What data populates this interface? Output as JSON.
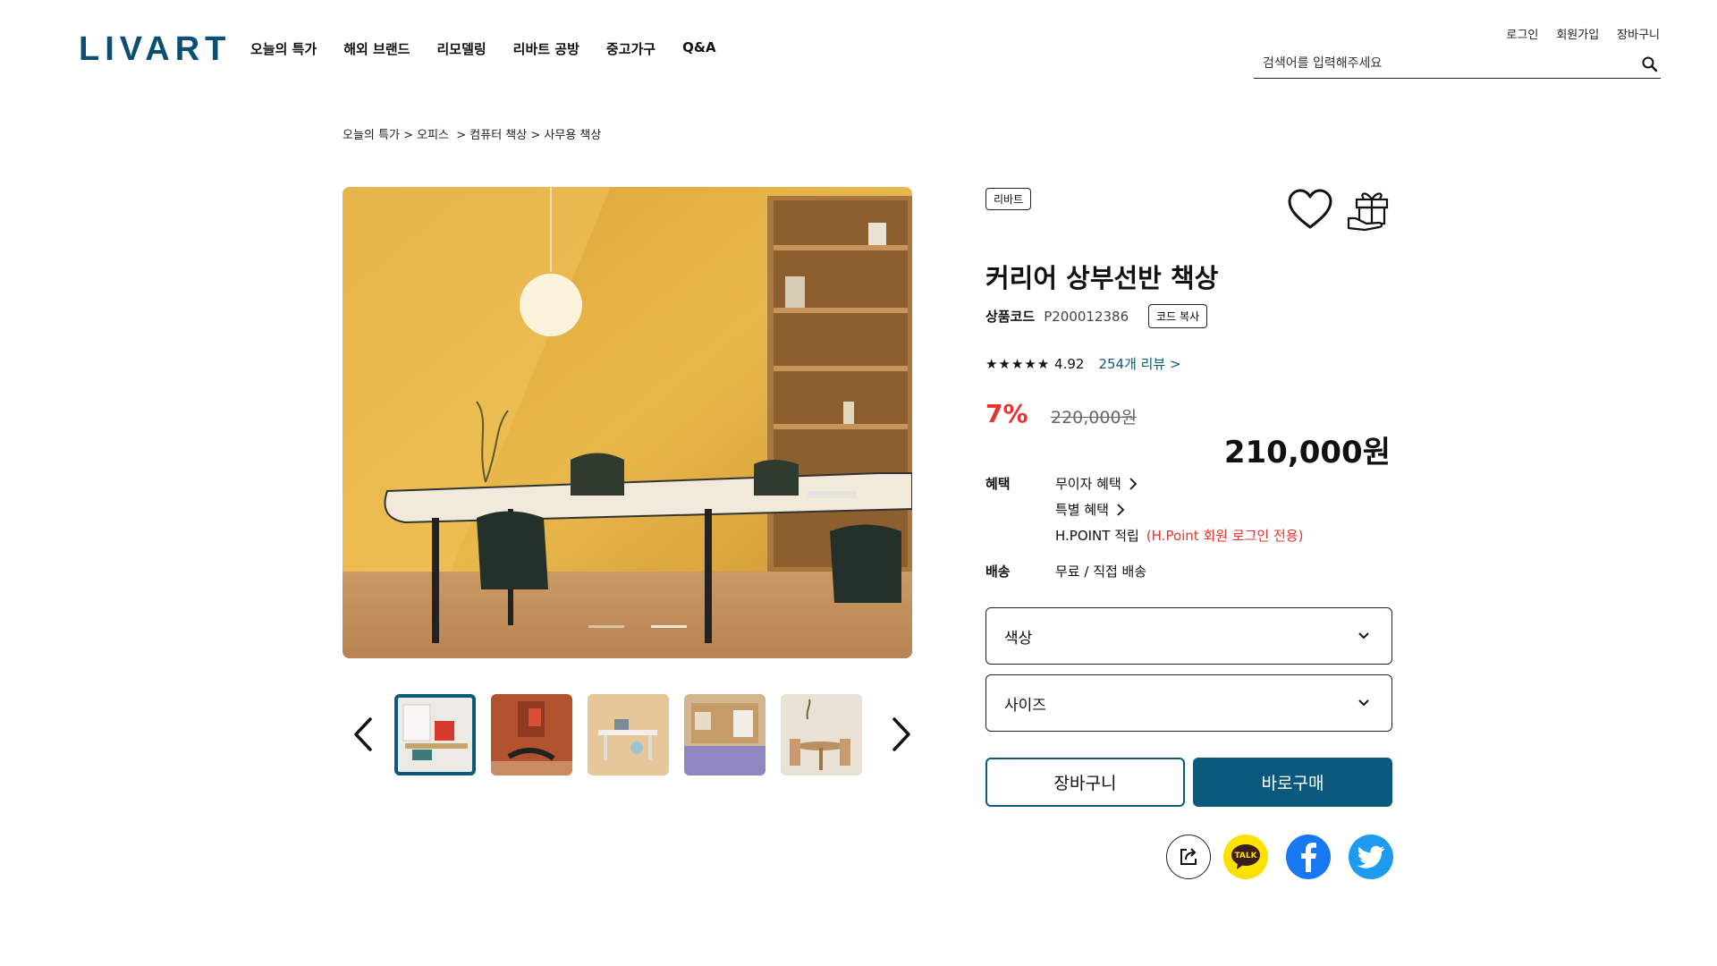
{
  "header": {
    "logo": "LIVART",
    "nav": [
      "오늘의 특가",
      "해외 브랜드",
      "리모델링",
      "리바트 공방",
      "중고가구",
      "Q&A"
    ],
    "util": [
      "로그인",
      "회원가입",
      "장바구니"
    ],
    "search_placeholder": "검색어를 입력해주세요"
  },
  "breadcrumb": [
    "오늘의 특가",
    "오피스",
    "컴퓨터 책상",
    "사무용 책상"
  ],
  "product": {
    "brand_badge": "리바트",
    "title": "커리어 상부선반 책상",
    "code_label": "상품코드",
    "code": "P200012386",
    "copy_label": "코드 복사",
    "stars": "★★★★★",
    "rating": "4.92",
    "review_link": "254개 리뷰 >",
    "discount": "7%",
    "original_price": "220,000원",
    "price": "210,000원"
  },
  "benefits": {
    "label": "혜택",
    "items": [
      "무이자 혜택",
      "특별 혜택"
    ],
    "hpoint": "H.POINT 적립",
    "hpoint_note": "(H.Point 회원 로그인 전용)"
  },
  "shipping": {
    "label": "배송",
    "value": "무료 / 직접 배송"
  },
  "options": {
    "color_label": "색상",
    "size_label": "사이즈"
  },
  "buttons": {
    "cart": "장바구니",
    "buy": "바로구매"
  },
  "share": {
    "kakao_label": "TALK"
  },
  "colors": {
    "brand": "#0b5a7e",
    "discount": "#e8322b",
    "kakao": "#fae100",
    "facebook": "#1877f2",
    "twitter": "#1d9bf0"
  }
}
